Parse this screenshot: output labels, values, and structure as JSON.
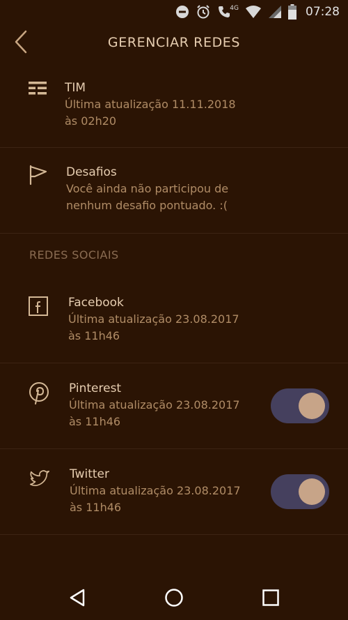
{
  "status_bar": {
    "time": "07:28",
    "network_label": "4G",
    "icons": [
      "do-not-disturb-icon",
      "alarm-icon",
      "call-4g-icon",
      "wifi-icon",
      "signal-icon",
      "battery-icon"
    ]
  },
  "header": {
    "title": "GERENCIAR REDES",
    "back_icon": "back-chevron-icon"
  },
  "accounts": [
    {
      "name": "TIM",
      "subtitle": "Última atualização 11.11.2018 às 02h20",
      "icon": "list-icon"
    },
    {
      "name": "Desafios",
      "subtitle": "Você ainda não participou de nenhum desafio pontuado. :(",
      "icon": "flag-icon"
    }
  ],
  "social_section": {
    "header": "REDES SOCIAIS",
    "items": [
      {
        "name": "Facebook",
        "subtitle": "Última atualização 23.08.2017 às 11h46",
        "icon": "facebook-icon",
        "has_toggle": false
      },
      {
        "name": "Pinterest",
        "subtitle": "Última atualização 23.08.2017 às 11h46",
        "icon": "pinterest-icon",
        "has_toggle": true,
        "toggle_on": true
      },
      {
        "name": "Twitter",
        "subtitle": "Última atualização 23.08.2017 às 11h46",
        "icon": "twitter-icon",
        "has_toggle": true,
        "toggle_on": true
      }
    ]
  },
  "navigation": {
    "buttons": [
      "back-triangle-icon",
      "home-circle-icon",
      "recents-square-icon"
    ]
  },
  "colors": {
    "background": "#2b1404",
    "primary_text": "#e6cdb0",
    "secondary_text": "#b08c66",
    "section_header": "#8a6c52",
    "toggle_track": "#45405e",
    "toggle_knob": "#c7a488"
  }
}
